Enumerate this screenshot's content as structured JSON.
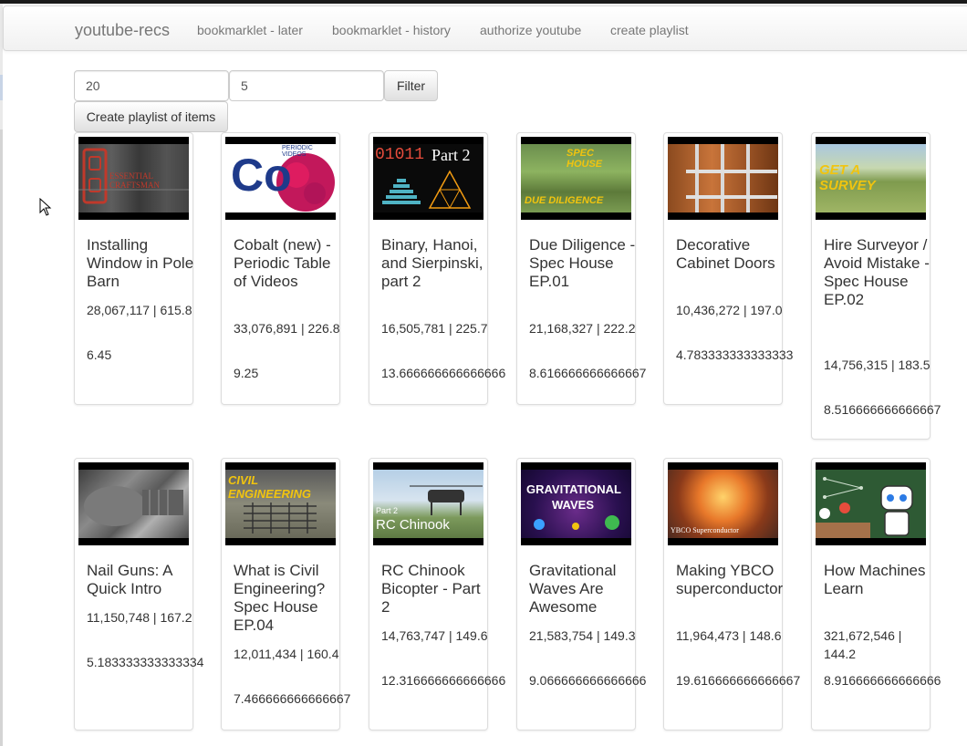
{
  "navbar": {
    "brand": "youtube-recs",
    "links": [
      "bookmarklet - later",
      "bookmarklet - history",
      "authorize youtube",
      "create playlist"
    ]
  },
  "filter": {
    "input1_value": "20",
    "input2_value": "5",
    "filter_label": "Filter",
    "create_label": "Create playlist of items"
  },
  "videos": [
    {
      "title": "Installing Window in Pole Barn",
      "stats": "28,067,117 | 615.8",
      "score": "6.45"
    },
    {
      "title": "Cobalt (new) - Periodic Table of Videos",
      "stats": "33,076,891 | 226.8",
      "score": "9.25"
    },
    {
      "title": "Binary, Hanoi, and Sierpinski, part 2",
      "stats": "16,505,781 | 225.7",
      "score": "13.666666666666666"
    },
    {
      "title": "Due Diligence - Spec House EP.01",
      "stats": "21,168,327 | 222.2",
      "score": "8.616666666666667"
    },
    {
      "title": "Decorative Cabinet Doors",
      "stats": "10,436,272 | 197.0",
      "score": "4.783333333333333"
    },
    {
      "title": "Hire Surveyor / Avoid Mistake - Spec House EP.02",
      "stats": "14,756,315 | 183.5",
      "score": "8.516666666666667"
    },
    {
      "title": "Nail Guns: A Quick Intro",
      "stats": "11,150,748 | 167.2",
      "score": "5.183333333333334"
    },
    {
      "title": "What is Civil Engineering? Spec House EP.04",
      "stats": "12,011,434 | 160.4",
      "score": "7.466666666666667"
    },
    {
      "title": "RC Chinook Bicopter - Part 2",
      "stats": "14,763,747 | 149.6",
      "score": "12.316666666666666"
    },
    {
      "title": "Gravitational Waves Are Awesome",
      "stats": "21,583,754 | 149.3",
      "score": "9.066666666666666"
    },
    {
      "title": "Making YBCO superconductor",
      "stats": "11,964,473 | 148.6",
      "score": "19.616666666666667"
    },
    {
      "title": "How Machines Learn",
      "stats": "321,672,546 | 144.2",
      "score": "8.916666666666666"
    }
  ],
  "thumb_text": {
    "t0": "ESSENTIAL CRAFTSMAN",
    "t1_big": "Co",
    "t1_small": "PERIODIC VIDEOS",
    "t2_bin": "01011",
    "t2_part": "Part 2",
    "t3_top": "SPEC HOUSE",
    "t3_bottom": "DUE DILIGENCE",
    "t5": "GET A SURVEY",
    "t7": "CIVIL ENGINEERING",
    "t8_small": "Part 2",
    "t8_big": "RC Chinook",
    "t9_a": "GRAVITATIONAL",
    "t9_b": "WAVES",
    "t10": "YBCO Superconductor"
  }
}
